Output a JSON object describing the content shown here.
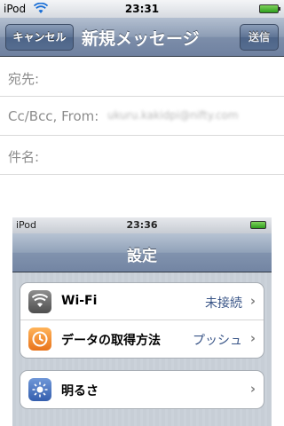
{
  "status_bar": {
    "carrier": "iPod",
    "time": "23:31"
  },
  "nav": {
    "cancel_label": "キャンセル",
    "title": "新規メッセージ",
    "send_label": "送信"
  },
  "compose": {
    "to_label": "宛先:",
    "ccbcc_label": "Cc/Bcc, From:",
    "from_value": "ukuru.kakidpi@nifty.com",
    "subject_label": "件名:"
  },
  "attached_screenshot": {
    "status_bar": {
      "carrier": "iPod",
      "time": "23:36"
    },
    "title": "設定",
    "rows": [
      {
        "label": "Wi-Fi",
        "value": "未接続",
        "icon": "wifi-icon"
      },
      {
        "label": "データの取得方法",
        "value": "プッシュ",
        "icon": "fetch-icon"
      },
      {
        "label": "明るさ",
        "value": "",
        "icon": "brightness-icon"
      }
    ]
  },
  "colors": {
    "navbar": "#7d8eaa",
    "value_text": "#385487",
    "label_gray": "#8c8c8c"
  }
}
